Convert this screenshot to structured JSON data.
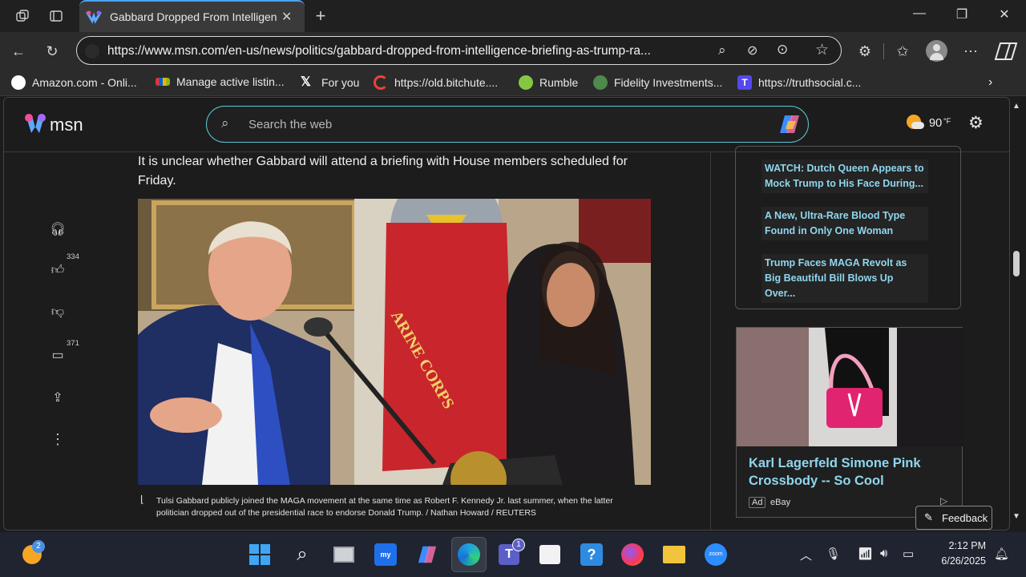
{
  "browser": {
    "tab_title": "Gabbard Dropped From Intelligence Briefing as Trump Rages",
    "url": "https://www.msn.com/en-us/news/politics/gabbard-dropped-from-intelligence-briefing-as-trump-ra..."
  },
  "bookmarks": [
    {
      "label": "Amazon.com - Onli...",
      "icon": "amazon-icon",
      "color": "#ffffff"
    },
    {
      "label": "Manage active listin...",
      "icon": "ebay-icon",
      "color": "#e53238"
    },
    {
      "label": "For you",
      "icon": "x-icon",
      "color": "#ffffff"
    },
    {
      "label": "https://old.bitchute....",
      "icon": "bitchute-icon",
      "color": "#ef4137"
    },
    {
      "label": "Rumble",
      "icon": "rumble-icon",
      "color": "#85c742"
    },
    {
      "label": "Fidelity Investments...",
      "icon": "fidelity-icon",
      "color": "#4d8a4b"
    },
    {
      "label": "https://truthsocial.c...",
      "icon": "truthsocial-icon",
      "color": "#5448ee"
    }
  ],
  "msn": {
    "logo_text": "msn",
    "search_placeholder": "Search the web",
    "weather": "90",
    "weather_unit": "°F"
  },
  "rail": {
    "likes": "334",
    "comments": "371"
  },
  "article": {
    "paragraph": "It is unclear whether Gabbard will attend a briefing with House members scheduled for Friday.",
    "photo_flag_text": "ARINE CORPS",
    "caption": "Tulsi Gabbard publicly joined the MAGA movement at the same time as Robert F. Kennedy Jr. last summer, when the latter politician dropped out of the presidential race to endorse Donald Trump. / Nathan Howard / REUTERS"
  },
  "sidebar_news": [
    "WATCH: Dutch Queen Appears to Mock Trump to His Face During...",
    "A New, Ultra-Rare Blood Type Found in Only One Woman",
    "Trump Faces MAGA Revolt as Big Beautiful Bill Blows Up Over..."
  ],
  "ad": {
    "title": "Karl Lagerfeld Simone Pink Crossbody -- So Cool",
    "badge": "Ad",
    "source": "eBay"
  },
  "feedback_label": "Feedback",
  "taskbar": {
    "widgets_badge": "2",
    "teams_badge": "1",
    "time": "2:12 PM",
    "date": "6/26/2025"
  }
}
